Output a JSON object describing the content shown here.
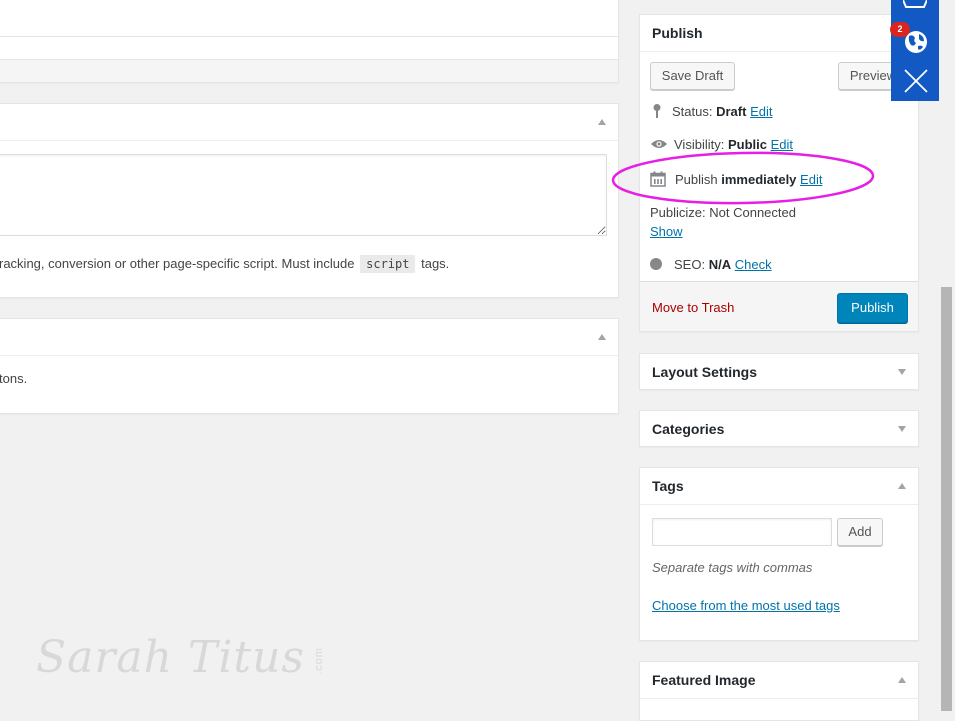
{
  "main": {
    "script_help_text": "racking, conversion or other page-specific script. Must include",
    "script_code": "script",
    "script_help_suffix": "tags.",
    "box3_text": "tons."
  },
  "publish": {
    "title": "Publish",
    "save_draft": "Save Draft",
    "preview": "Preview",
    "status_label": "Status:",
    "status_value": "Draft",
    "visibility_label": "Visibility:",
    "visibility_value": "Public",
    "schedule_label": "Publish",
    "schedule_value": "immediately",
    "edit": "Edit",
    "publicize": "Publicize: Not Connected",
    "show": "Show",
    "seo_label": "SEO:",
    "seo_value": "N/A",
    "seo_check": "Check",
    "trash": "Move to Trash",
    "publish_button": "Publish"
  },
  "layout_settings": {
    "title": "Layout Settings"
  },
  "categories": {
    "title": "Categories"
  },
  "tags": {
    "title": "Tags",
    "input_value": "",
    "add": "Add",
    "hint": "Separate tags with commas",
    "choose": "Choose from the most used tags"
  },
  "featured_image": {
    "title": "Featured Image"
  },
  "toolbar": {
    "badge_count": "2"
  },
  "watermark": {
    "text": "Sarah Titus",
    "suffix": ".com"
  },
  "colors": {
    "primary": "#0085ba",
    "trash": "#a00",
    "annotation": "#e61ee6",
    "toolbar": "#1259c3",
    "badge": "#d9251d"
  }
}
